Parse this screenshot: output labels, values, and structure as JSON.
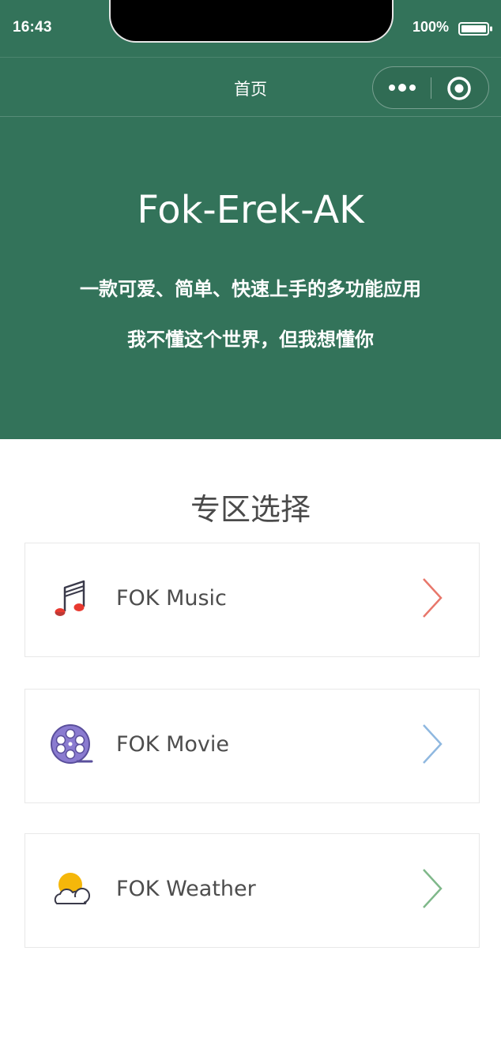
{
  "status_bar": {
    "time": "16:43",
    "battery": "100%"
  },
  "nav": {
    "title": "首页"
  },
  "hero": {
    "title": "Fok-Erek-AK",
    "line1": "一款可爱、简单、快速上手的多功能应用",
    "line2": "我不懂这个世界，但我想懂你"
  },
  "section": {
    "title": "专区选择",
    "items": [
      {
        "label": "FOK Music",
        "icon": "music-note-icon",
        "chevron_color": "#e8776b"
      },
      {
        "label": "FOK Movie",
        "icon": "film-reel-icon",
        "chevron_color": "#8fb8e0"
      },
      {
        "label": "FOK Weather",
        "icon": "weather-sun-cloud-icon",
        "chevron_color": "#7fb88a"
      }
    ]
  },
  "colors": {
    "header_bg": "#33735a",
    "text_dark": "#4d4d4d"
  }
}
